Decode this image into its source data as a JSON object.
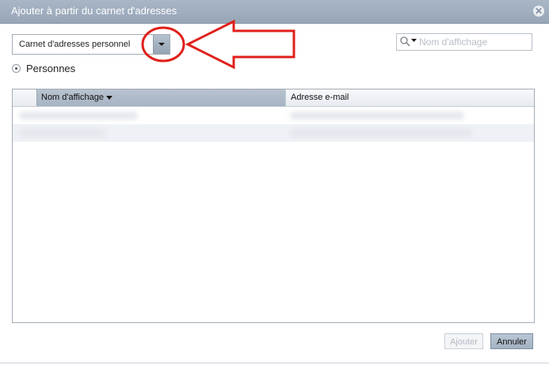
{
  "dialog": {
    "title": "Ajouter à partir du carnet d'adresses",
    "close_icon": "close-icon"
  },
  "address_book_select": {
    "value": "Carnet d'adresses personnel",
    "icon": "chevron-down-icon"
  },
  "annotation": {
    "color": "#e0201b",
    "shapes": [
      "circle",
      "arrow-left"
    ]
  },
  "search": {
    "placeholder": "Nom d'affichage",
    "value": "",
    "icon": "search-icon"
  },
  "scope": {
    "label": "Personnes",
    "selected": true
  },
  "table": {
    "columns": [
      "Nom d'affichage",
      "Adresse e-mail"
    ],
    "sort_column": "Nom d'affichage",
    "sort_direction": "descending",
    "rows_blurred": 2
  },
  "buttons": {
    "add_label": "Ajouter",
    "add_enabled": false,
    "cancel_label": "Annuler"
  },
  "colors": {
    "titlebar": "#a3b1c2",
    "accent": "#aab7c6",
    "annotation": "#e0201b"
  }
}
